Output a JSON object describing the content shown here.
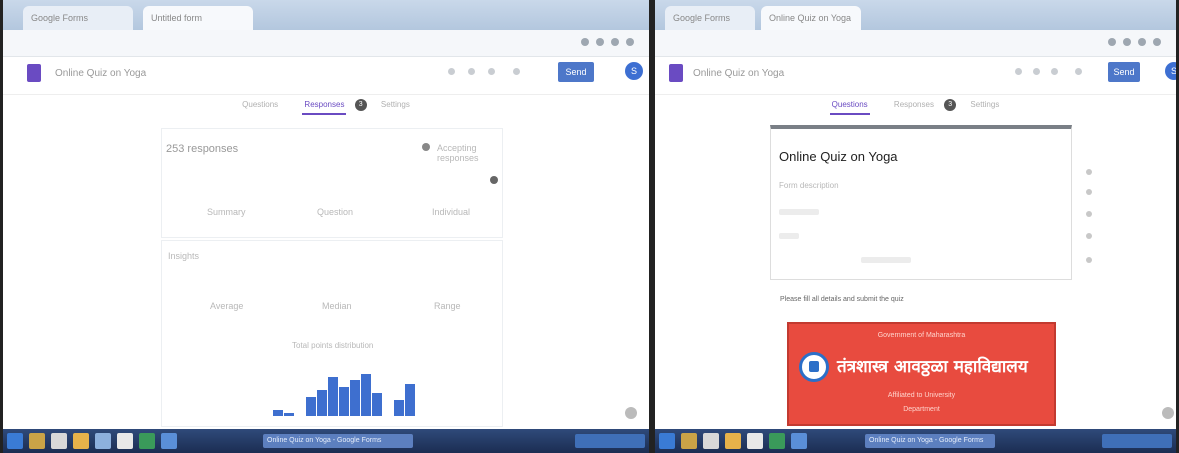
{
  "left": {
    "tabs": [
      "Google Forms",
      "Untitled form"
    ],
    "form_title": "Online Quiz on Yoga",
    "send_label": "Send",
    "avatar": "S",
    "form_tabs": [
      "Questions",
      "Responses",
      "Settings"
    ],
    "responses_badge": "3",
    "summary": {
      "title": "253 responses",
      "toggle_label": "Accepting responses",
      "subtabs": [
        "Summary",
        "Question",
        "Individual"
      ],
      "insights_label": "Insights",
      "stats": [
        {
          "label": "Average",
          "value": ""
        },
        {
          "label": "Median",
          "value": ""
        },
        {
          "label": "Range",
          "value": ""
        }
      ],
      "histogram_title": "Total points distribution"
    },
    "histogram_values": [
      2,
      1,
      0,
      6,
      8,
      12,
      9,
      11,
      13,
      7,
      0,
      5,
      10
    ]
  },
  "right": {
    "tabs": [
      "Google Forms",
      "Online Quiz on Yoga"
    ],
    "send_label": "Send",
    "avatar": "S",
    "form_tabs": [
      "Questions",
      "Responses",
      "Settings"
    ],
    "quiz_title": "Online Quiz on Yoga",
    "quiz_desc": "Form description",
    "quiz_desc_line": "Please fill all details and submit the quiz",
    "banner": {
      "top": "Government of Maharashtra",
      "main": "तंत्रशास्त्र आवठ्ठळा महाविद्यालय",
      "sub": "Affiliated to University",
      "sub2": "Department"
    }
  },
  "taskbar": {
    "left_window": "Online Quiz on Yoga - Google Forms",
    "right_window": "Online Quiz on Yoga - Google Forms"
  },
  "colors": {
    "accent": "#6a4bc2",
    "send": "#4d77c9",
    "bar": "#3e6fcf",
    "banner": "#e84b3f"
  },
  "icons": [
    "forms-icon",
    "palette-icon",
    "eye-icon",
    "settings-icon",
    "more-icon"
  ]
}
